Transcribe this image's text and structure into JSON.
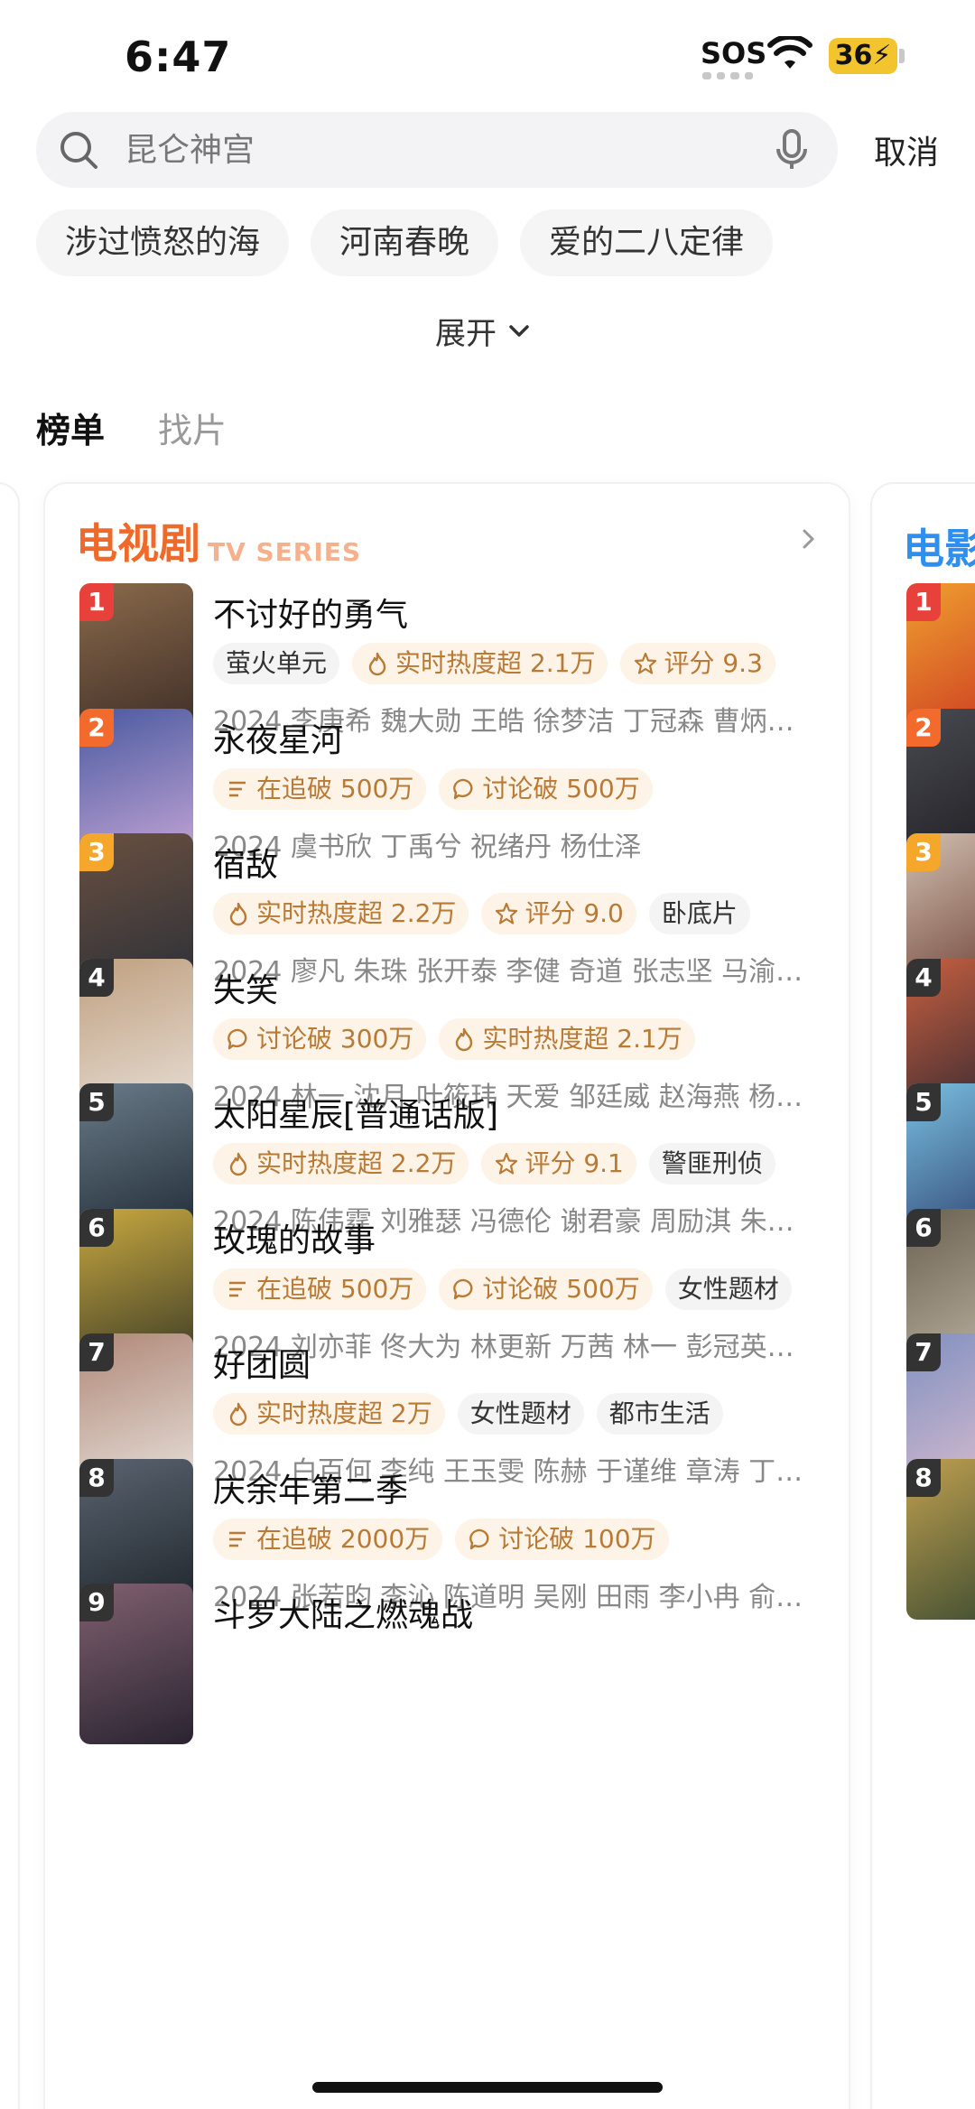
{
  "status_bar": {
    "time": "6:47",
    "sos": "SOS",
    "battery": "36"
  },
  "search": {
    "placeholder": "昆仑神宫",
    "cancel_label": "取消"
  },
  "history": [
    "涉过愤怒的海",
    "河南春晚",
    "爱的二八定律"
  ],
  "expand_label": "展开",
  "tabs": {
    "ranking": "榜单",
    "find": "找片"
  },
  "tv_card": {
    "title": "电视剧",
    "subtitle": "TV SERIES",
    "items": [
      {
        "rank": "1",
        "title": "不讨好的勇气",
        "tags": [
          "萤火单元",
          "实时热度超 2.1万",
          "评分 9.3"
        ],
        "meta": "2024 李庚希 魏大勋 王皓 徐梦洁 丁冠森 曹炳…"
      },
      {
        "rank": "2",
        "title": "永夜星河",
        "tags": [
          "在追破 500万",
          "讨论破 500万"
        ],
        "meta": "2024 虞书欣 丁禹兮 祝绪丹 杨仕泽"
      },
      {
        "rank": "3",
        "title": "宿敌",
        "tags": [
          "实时热度超 2.2万",
          "评分 9.0",
          "卧底片"
        ],
        "meta": "2024 廖凡 朱珠 张开泰 李健 奇道 张志坚 马渝…"
      },
      {
        "rank": "4",
        "title": "失笑",
        "tags": [
          "讨论破 300万",
          "实时热度超 2.1万"
        ],
        "meta": "2024 林一 沈月 叶筱玮 天爱 邹廷威 赵海燕 杨…"
      },
      {
        "rank": "5",
        "title": "太阳星辰[普通话版]",
        "tags": [
          "实时热度超 2.2万",
          "评分 9.1",
          "警匪刑侦"
        ],
        "meta": "2024 陈伟霆 刘雅瑟 冯德伦 谢君豪 周励淇 朱…"
      },
      {
        "rank": "6",
        "title": "玫瑰的故事",
        "tags": [
          "在追破 500万",
          "讨论破 500万",
          "女性题材"
        ],
        "meta": "2024 刘亦菲 佟大为 林更新 万茜 林一 彭冠英…"
      },
      {
        "rank": "7",
        "title": "好团圆",
        "tags": [
          "实时热度超 2万",
          "女性题材",
          "都市生活"
        ],
        "meta": "2024 白百何 李纯 王玉雯 陈赫 于谨维 章涛 丁…"
      },
      {
        "rank": "8",
        "title": "庆余年第二季",
        "tags": [
          "在追破 2000万",
          "讨论破 100万"
        ],
        "meta": "2024 张若昀 李沁 陈道明 吴刚 田雨 李小冉 俞…"
      },
      {
        "rank": "9",
        "title": "斗罗大陆之燃魂战",
        "tags": [],
        "meta": ""
      }
    ]
  },
  "movie_card": {
    "title": "电影"
  },
  "colors": {
    "accent_orange": "#ee6a2a",
    "rank1": "#e8413c",
    "rank2": "#f26b2c",
    "rank3": "#f4a72b",
    "rank_other": "#333333",
    "movie_blue": "#2f8ff0"
  }
}
